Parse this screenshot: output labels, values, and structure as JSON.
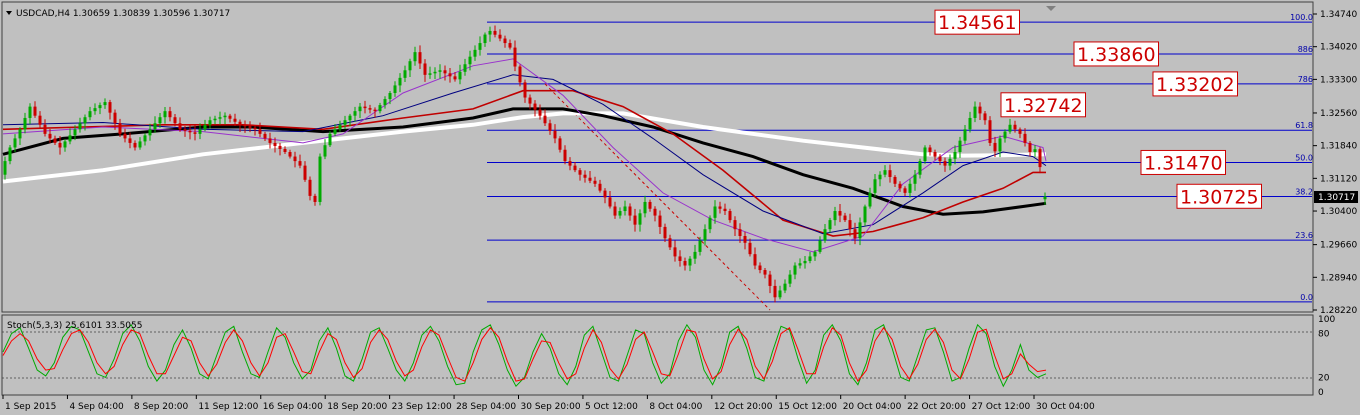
{
  "chart_header": {
    "symbol_line": "USDCAD,H4  1.30659 1.30839 1.30596 1.30717"
  },
  "indicator_header": {
    "text": "Stoch(5,3,3) 25.6101 33.5055"
  },
  "current_price": "1.30717",
  "colors": {
    "background": "#c0c0c0",
    "bull_candle": "#00aa00",
    "bear_candle": "#cc0000",
    "fib_line": "#0000cc",
    "callout": "#cc0000",
    "ma_black": "#000000",
    "ma_white": "#ffffff",
    "ma_red": "#c00000",
    "ma_navy": "#000080",
    "ma_purple": "#9933cc",
    "stoch_main": "#00aa00",
    "stoch_signal": "#ff0000"
  },
  "chart_data": [
    {
      "type": "candlestick",
      "symbol": "USDCAD",
      "timeframe": "H4",
      "ohlc_last": {
        "open": 1.30659,
        "high": 1.30839,
        "low": 1.30596,
        "close": 1.30717
      },
      "ylim": [
        1.2822,
        1.3474
      ],
      "y_ticks": [
        "1.34740",
        "1.34020",
        "1.33300",
        "1.32560",
        "1.31840",
        "1.31120",
        "1.30400",
        "1.29660",
        "1.28940",
        "1.28220"
      ],
      "x_ticks": [
        "1 Sep 2015",
        "4 Sep 04:00",
        "8 Sep 20:00",
        "11 Sep 12:00",
        "16 Sep 04:00",
        "18 Sep 20:00",
        "23 Sep 12:00",
        "28 Sep 04:00",
        "30 Sep 20:00",
        "5 Oct 12:00",
        "8 Oct 04:00",
        "12 Oct 20:00",
        "15 Oct 12:00",
        "20 Oct 04:00",
        "22 Oct 20:00",
        "27 Oct 12:00",
        "30 Oct 04:00"
      ],
      "price_path": [
        [
          0,
          1.312
        ],
        [
          10,
          1.318
        ],
        [
          20,
          1.322
        ],
        [
          30,
          1.327
        ],
        [
          45,
          1.321
        ],
        [
          60,
          1.318
        ],
        [
          75,
          1.322
        ],
        [
          90,
          1.326
        ],
        [
          105,
          1.328
        ],
        [
          120,
          1.321
        ],
        [
          135,
          1.318
        ],
        [
          150,
          1.322
        ],
        [
          165,
          1.326
        ],
        [
          180,
          1.322
        ],
        [
          195,
          1.321
        ],
        [
          210,
          1.324
        ],
        [
          225,
          1.325
        ],
        [
          240,
          1.323
        ],
        [
          255,
          1.322
        ],
        [
          270,
          1.319
        ],
        [
          285,
          1.317
        ],
        [
          300,
          1.314
        ],
        [
          308,
          1.309
        ],
        [
          314,
          1.304
        ],
        [
          320,
          1.316
        ],
        [
          330,
          1.321
        ],
        [
          345,
          1.324
        ],
        [
          360,
          1.327
        ],
        [
          375,
          1.326
        ],
        [
          390,
          1.33
        ],
        [
          405,
          1.335
        ],
        [
          415,
          1.339
        ],
        [
          425,
          1.334
        ],
        [
          440,
          1.335
        ],
        [
          455,
          1.333
        ],
        [
          470,
          1.338
        ],
        [
          480,
          1.341
        ],
        [
          488,
          1.344
        ],
        [
          500,
          1.342
        ],
        [
          510,
          1.34
        ],
        [
          516,
          1.335
        ],
        [
          525,
          1.329
        ],
        [
          540,
          1.325
        ],
        [
          555,
          1.32
        ],
        [
          565,
          1.315
        ],
        [
          580,
          1.312
        ],
        [
          595,
          1.31
        ],
        [
          605,
          1.307
        ],
        [
          615,
          1.303
        ],
        [
          625,
          1.305
        ],
        [
          635,
          1.301
        ],
        [
          645,
          1.306
        ],
        [
          655,
          1.303
        ],
        [
          665,
          1.298
        ],
        [
          675,
          1.294
        ],
        [
          685,
          1.292
        ],
        [
          695,
          1.295
        ],
        [
          705,
          1.3
        ],
        [
          715,
          1.305
        ],
        [
          725,
          1.304
        ],
        [
          735,
          1.3
        ],
        [
          745,
          1.297
        ],
        [
          755,
          1.292
        ],
        [
          765,
          1.29
        ],
        [
          775,
          1.285
        ],
        [
          785,
          1.288
        ],
        [
          795,
          1.292
        ],
        [
          805,
          1.293
        ],
        [
          815,
          1.295
        ],
        [
          825,
          1.3
        ],
        [
          835,
          1.304
        ],
        [
          845,
          1.302
        ],
        [
          855,
          1.298
        ],
        [
          865,
          1.305
        ],
        [
          875,
          1.311
        ],
        [
          885,
          1.313
        ],
        [
          895,
          1.31
        ],
        [
          905,
          1.308
        ],
        [
          915,
          1.312
        ],
        [
          925,
          1.318
        ],
        [
          935,
          1.316
        ],
        [
          945,
          1.314
        ],
        [
          955,
          1.317
        ],
        [
          965,
          1.322
        ],
        [
          975,
          1.327
        ],
        [
          985,
          1.324
        ],
        [
          993,
          1.316
        ],
        [
          1000,
          1.32
        ],
        [
          1010,
          1.323
        ],
        [
          1020,
          1.321
        ],
        [
          1030,
          1.317
        ],
        [
          1038,
          1.318
        ],
        [
          1043,
          1.3072
        ]
      ],
      "moving_averages": [
        {
          "color_key": "ma_white",
          "width": 4,
          "points": [
            [
              0,
              1.3105
            ],
            [
              100,
              1.313
            ],
            [
              200,
              1.3165
            ],
            [
              300,
              1.319
            ],
            [
              400,
              1.3215
            ],
            [
              470,
              1.323
            ],
            [
              520,
              1.3247
            ],
            [
              560,
              1.3255
            ],
            [
              620,
              1.3255
            ],
            [
              700,
              1.3225
            ],
            [
              800,
              1.3195
            ],
            [
              860,
              1.318
            ],
            [
              920,
              1.3165
            ],
            [
              960,
              1.3162
            ],
            [
              1000,
              1.3163
            ],
            [
              1043,
              1.3165
            ]
          ]
        },
        {
          "color_key": "ma_black",
          "width": 3,
          "points": [
            [
              0,
              1.3165
            ],
            [
              60,
              1.32
            ],
            [
              120,
              1.321
            ],
            [
              200,
              1.3225
            ],
            [
              250,
              1.3225
            ],
            [
              320,
              1.3215
            ],
            [
              400,
              1.3225
            ],
            [
              470,
              1.3245
            ],
            [
              510,
              1.3265
            ],
            [
              560,
              1.3265
            ],
            [
              600,
              1.325
            ],
            [
              650,
              1.3225
            ],
            [
              700,
              1.319
            ],
            [
              750,
              1.316
            ],
            [
              800,
              1.312
            ],
            [
              850,
              1.309
            ],
            [
              900,
              1.305
            ],
            [
              940,
              1.3033
            ],
            [
              980,
              1.3038
            ],
            [
              1020,
              1.305
            ],
            [
              1043,
              1.3057
            ]
          ]
        },
        {
          "color_key": "ma_red",
          "width": 1.6,
          "points": [
            [
              0,
              1.322
            ],
            [
              80,
              1.3225
            ],
            [
              160,
              1.323
            ],
            [
              240,
              1.323
            ],
            [
              320,
              1.322
            ],
            [
              400,
              1.3245
            ],
            [
              470,
              1.3265
            ],
            [
              520,
              1.3305
            ],
            [
              570,
              1.3305
            ],
            [
              620,
              1.327
            ],
            [
              670,
              1.321
            ],
            [
              720,
              1.313
            ],
            [
              780,
              1.302
            ],
            [
              830,
              1.2985
            ],
            [
              870,
              1.2995
            ],
            [
              920,
              1.3025
            ],
            [
              960,
              1.306
            ],
            [
              1000,
              1.309
            ],
            [
              1030,
              1.3125
            ],
            [
              1043,
              1.3125
            ]
          ]
        },
        {
          "color_key": "ma_navy",
          "width": 1,
          "points": [
            [
              0,
              1.323
            ],
            [
              100,
              1.3235
            ],
            [
              200,
              1.322
            ],
            [
              300,
              1.3215
            ],
            [
              380,
              1.325
            ],
            [
              450,
              1.33
            ],
            [
              510,
              1.334
            ],
            [
              550,
              1.333
            ],
            [
              600,
              1.3275
            ],
            [
              650,
              1.32
            ],
            [
              700,
              1.312
            ],
            [
              760,
              1.304
            ],
            [
              820,
              1.299
            ],
            [
              870,
              1.301
            ],
            [
              920,
              1.308
            ],
            [
              960,
              1.314
            ],
            [
              1000,
              1.317
            ],
            [
              1030,
              1.316
            ],
            [
              1043,
              1.314
            ]
          ]
        },
        {
          "color_key": "ma_purple",
          "width": 1,
          "points": [
            [
              0,
              1.321
            ],
            [
              100,
              1.3225
            ],
            [
              200,
              1.3215
            ],
            [
              300,
              1.319
            ],
            [
              340,
              1.321
            ],
            [
              400,
              1.33
            ],
            [
              470,
              1.336
            ],
            [
              510,
              1.3375
            ],
            [
              560,
              1.3295
            ],
            [
              610,
              1.318
            ],
            [
              660,
              1.308
            ],
            [
              710,
              1.302
            ],
            [
              760,
              1.298
            ],
            [
              810,
              1.295
            ],
            [
              860,
              1.2985
            ],
            [
              900,
              1.31
            ],
            [
              950,
              1.318
            ],
            [
              1000,
              1.3205
            ],
            [
              1040,
              1.318
            ],
            [
              1043,
              1.315
            ]
          ]
        }
      ],
      "fibonacci": {
        "levels": [
          {
            "label": "100.0",
            "price": 1.3456
          },
          {
            "label": "886",
            "price": 1.3386
          },
          {
            "label": "786",
            "price": 1.332
          },
          {
            "label": "61.8",
            "price": 1.3218
          },
          {
            "label": "50.0",
            "price": 1.3147
          },
          {
            "label": "38.2",
            "price": 1.3072
          },
          {
            "label": "23.6",
            "price": 1.2976
          },
          {
            "label": "0.0",
            "price": 1.284
          }
        ]
      },
      "callouts": [
        {
          "text": "1.34561",
          "price": 1.3456
        },
        {
          "text": "1.33860",
          "price": 1.3386
        },
        {
          "text": "1.33202",
          "price": 1.332
        },
        {
          "text": "1.32742",
          "price": 1.3274
        },
        {
          "text": "1.31470",
          "price": 1.3147
        },
        {
          "text": "1.30725",
          "price": 1.30725
        }
      ]
    },
    {
      "type": "line",
      "name": "Stoch(5,3,3)",
      "ylim": [
        0,
        100
      ],
      "y_ticks": [
        "100",
        "80",
        "20",
        "0"
      ],
      "series": [
        {
          "name": "main",
          "color_key": "stoch_main",
          "values": [
            55,
            80,
            88,
            60,
            30,
            22,
            40,
            75,
            90,
            85,
            55,
            25,
            20,
            45,
            80,
            92,
            70,
            35,
            15,
            30,
            65,
            85,
            60,
            25,
            18,
            50,
            82,
            90,
            55,
            25,
            20,
            55,
            88,
            75,
            40,
            18,
            30,
            70,
            88,
            60,
            22,
            15,
            45,
            82,
            88,
            60,
            30,
            15,
            40,
            78,
            90,
            70,
            35,
            10,
            12,
            55,
            85,
            92,
            65,
            30,
            8,
            20,
            55,
            80,
            60,
            25,
            10,
            35,
            78,
            90,
            55,
            20,
            15,
            50,
            85,
            80,
            40,
            12,
            25,
            70,
            92,
            75,
            30,
            10,
            35,
            82,
            90,
            60,
            20,
            15,
            55,
            90,
            85,
            45,
            12,
            30,
            78,
            92,
            70,
            25,
            10,
            40,
            85,
            92,
            60,
            20,
            15,
            50,
            85,
            88,
            55,
            15,
            20,
            60,
            92,
            80,
            35,
            8,
            30,
            65,
            30,
            20,
            25
          ]
        },
        {
          "name": "signal",
          "color_key": "stoch_signal",
          "values": [
            50,
            70,
            80,
            70,
            45,
            30,
            32,
            58,
            80,
            85,
            68,
            40,
            25,
            35,
            65,
            85,
            80,
            50,
            25,
            25,
            50,
            75,
            70,
            40,
            22,
            38,
            68,
            85,
            70,
            40,
            22,
            40,
            75,
            80,
            55,
            28,
            25,
            55,
            80,
            72,
            40,
            20,
            32,
            68,
            85,
            72,
            42,
            22,
            30,
            62,
            85,
            78,
            48,
            20,
            15,
            40,
            72,
            88,
            75,
            42,
            15,
            18,
            45,
            70,
            68,
            40,
            18,
            25,
            60,
            85,
            68,
            32,
            18,
            38,
            72,
            82,
            55,
            25,
            22,
            52,
            85,
            82,
            45,
            18,
            28,
            65,
            86,
            72,
            35,
            18,
            42,
            80,
            88,
            58,
            25,
            25,
            62,
            88,
            78,
            40,
            15,
            30,
            70,
            88,
            72,
            35,
            18,
            38,
            72,
            86,
            68,
            30,
            18,
            45,
            82,
            86,
            50,
            18,
            25,
            52,
            38,
            28,
            30
          ]
        }
      ]
    }
  ]
}
